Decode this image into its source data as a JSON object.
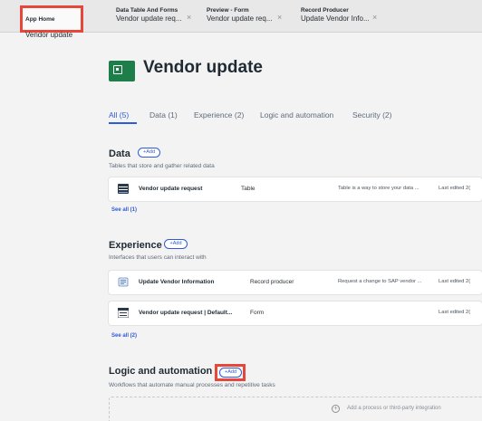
{
  "tabs": [
    {
      "line1": "App Home",
      "line2": "Vendor update"
    },
    {
      "line1": "Data Table And Forms",
      "line2": "Vendor update req..."
    },
    {
      "line1": "Preview - Form",
      "line2": "Vendor update req..."
    },
    {
      "line1": "Record Producer",
      "line2": "Update Vendor Info..."
    }
  ],
  "close_glyph": "×",
  "page": {
    "title": "Vendor update"
  },
  "filters": [
    "All (5)",
    "Data (1)",
    "Experience (2)",
    "Logic and automation",
    "Security (2)"
  ],
  "add_label": "+Add",
  "see_all_data": "See all (1)",
  "see_all_experience": "See all (2)",
  "data_section": {
    "title": "Data",
    "subtitle": "Tables that store and gather related data",
    "rows": [
      {
        "name": "Vendor update request",
        "type": "Table",
        "desc": "Table is a way to store your data ...",
        "edited": "Last edited 2("
      }
    ]
  },
  "experience_section": {
    "title": "Experience",
    "subtitle": "Interfaces that users can interact with",
    "rows": [
      {
        "name": "Update Vendor Information",
        "type": "Record producer",
        "desc": "Request a change to SAP vendor ...",
        "edited": "Last edited 2("
      },
      {
        "name": "Vendor update request | Default...",
        "type": "Form",
        "desc": "",
        "edited": "Last edited 2("
      }
    ]
  },
  "logic_section": {
    "title": "Logic and automation",
    "subtitle": "Workflows that automate manual processes and repetitive tasks",
    "empty_text": "Add a process or third-party integration"
  },
  "colors": {
    "accent": "#2e5bd8",
    "highlight": "#e5473a",
    "brand": "#1e7e4a"
  }
}
